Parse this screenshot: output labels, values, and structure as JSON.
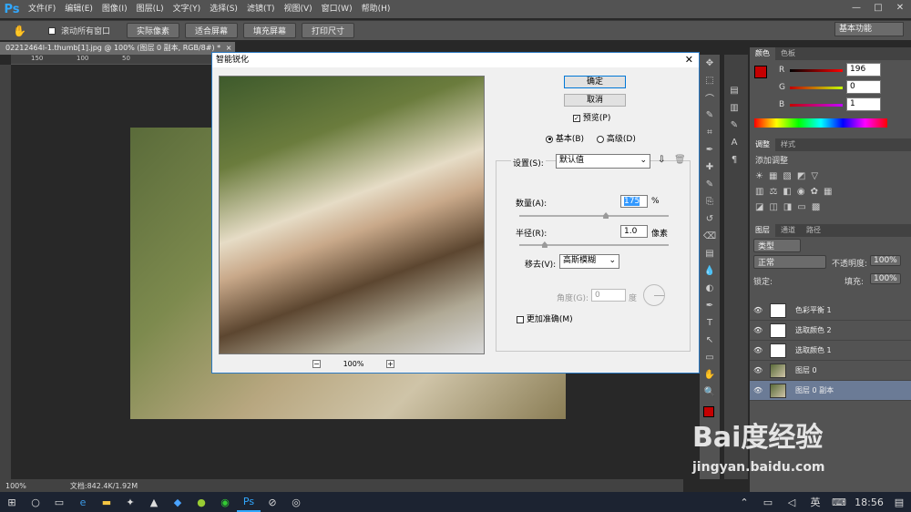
{
  "app": {
    "logo": "Ps"
  },
  "menu": [
    "文件(F)",
    "编辑(E)",
    "图像(I)",
    "图层(L)",
    "文字(Y)",
    "选择(S)",
    "滤镜(T)",
    "视图(V)",
    "窗口(W)",
    "帮助(H)"
  ],
  "window_controls": {
    "min": "—",
    "max": "□",
    "close": "✕"
  },
  "options": {
    "scroll_all": "滚动所有窗口",
    "buttons": [
      "实际像素",
      "适合屏幕",
      "填充屏幕",
      "打印尺寸"
    ],
    "workspace": "基本功能"
  },
  "document": {
    "tab_title": "02212464l-1.thumb[1].jpg @ 100% (图层 0 副本, RGB/8#) *",
    "tab_close": "×",
    "ruler_marks": [
      "150",
      "100",
      "50"
    ]
  },
  "status": {
    "zoom": "100%",
    "doc_info": "文档:842.4K/1.92M"
  },
  "dialog": {
    "title": "智能锐化",
    "close": "✕",
    "ok": "确定",
    "cancel": "取消",
    "preview_label": "预览(P)",
    "mode_basic": "基本(B)",
    "mode_advanced": "高级(D)",
    "settings_label": "设置(S):",
    "settings_value": "默认值",
    "amount_label": "数量(A):",
    "amount_value": "175",
    "amount_unit": "%",
    "amount_fraction": 0.58,
    "radius_label": "半径(R):",
    "radius_value": "1.0",
    "radius_unit": "像素",
    "radius_fraction": 0.17,
    "remove_label": "移去(V):",
    "remove_value": "高斯模糊",
    "angle_label": "角度(G):",
    "angle_value": "0",
    "angle_unit": "度",
    "more_accurate": "更加准确(M)",
    "zoom": "100%",
    "zoom_minus": "−",
    "zoom_plus": "+"
  },
  "color_panel": {
    "tabs": [
      "颜色",
      "色板"
    ],
    "r_label": "R",
    "r_value": "196",
    "g_label": "G",
    "g_value": "0",
    "b_label": "B",
    "b_value": "1",
    "foreground": "#c40001"
  },
  "adjust_panel": {
    "tabs": [
      "调整",
      "样式"
    ],
    "add_label": "添加调整"
  },
  "layers_panel": {
    "tabs": [
      "图层",
      "通道",
      "路径"
    ],
    "kind": "类型",
    "blend": "正常",
    "opacity_label": "不透明度:",
    "opacity_value": "100%",
    "lock_label": "锁定:",
    "fill_label": "填充:",
    "fill_value": "100%",
    "layers": [
      {
        "name": "色彩平衡 1",
        "type": "adjust"
      },
      {
        "name": "选取颜色 2",
        "type": "adjust"
      },
      {
        "name": "选取颜色 1",
        "type": "adjust"
      },
      {
        "name": "图层 0",
        "type": "image"
      },
      {
        "name": "图层 0 副本",
        "type": "image",
        "selected": true
      }
    ]
  },
  "taskbar": {
    "ime": "英",
    "time": "18:56"
  },
  "watermark": {
    "brand": "Bai度经验",
    "url": "jingyan.baidu.com"
  }
}
